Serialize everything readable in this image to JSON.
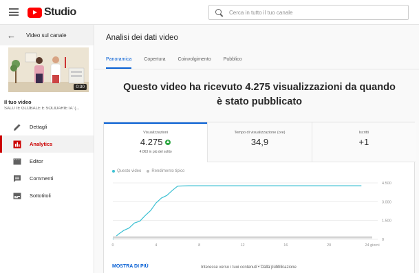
{
  "header": {
    "logo_text": "Studio",
    "search_placeholder": "Cerca in tutto il tuo canale",
    "brand_color": "#ff0000"
  },
  "sidebar": {
    "back_label": "Video sul canale",
    "thumbnail_duration": "0:30",
    "your_video_label": "Il tuo video",
    "channel_name": "SALUTE GLOBALE E SOLIDARIETA' (...",
    "items": [
      {
        "label": "Dettagli",
        "icon": "pencil-icon",
        "active": false
      },
      {
        "label": "Analytics",
        "icon": "analytics-icon",
        "active": true
      },
      {
        "label": "Editor",
        "icon": "film-icon",
        "active": false
      },
      {
        "label": "Commenti",
        "icon": "comment-icon",
        "active": false
      },
      {
        "label": "Sottotitoli",
        "icon": "subtitles-icon",
        "active": false
      }
    ]
  },
  "main": {
    "title": "Analisi dei dati video",
    "tabs": [
      {
        "label": "Panoramica",
        "active": true
      },
      {
        "label": "Copertura",
        "active": false
      },
      {
        "label": "Coinvolgimento",
        "active": false
      },
      {
        "label": "Pubblico",
        "active": false
      }
    ],
    "headline": "Questo video ha ricevuto 4.275 visualizzazioni da quando è stato pubblicato",
    "metrics": [
      {
        "label": "Visualizzazioni",
        "value": "4.275",
        "sub": "4.063 in più del solito",
        "trend": "up"
      },
      {
        "label": "Tempo di visualizzazione (ore)",
        "value": "34,9",
        "sub": ""
      },
      {
        "label": "Iscritti",
        "value": "+1",
        "sub": ""
      }
    ],
    "legend": {
      "this_video": "Questo video",
      "typical": "Rendimento tipico"
    },
    "show_more": "MOSTRA DI PIÙ",
    "footer_text": "Interesse verso i tuoi contenuti • Dalla pubblicazione"
  },
  "chart_data": {
    "type": "line",
    "x_tick_labels": [
      "0",
      "4",
      "8",
      "12",
      "16",
      "20",
      "24 giorni"
    ],
    "y_tick_labels": [
      "0",
      "1.500",
      "3.000",
      "4.500"
    ],
    "xlim": [
      0,
      24
    ],
    "ylim": [
      0,
      4500
    ],
    "series": [
      {
        "name": "Questo video",
        "color": "#3ec1d3",
        "x": [
          0,
          0.5,
          1,
          1.5,
          2,
          2.5,
          3,
          3.5,
          4,
          4.5,
          5,
          5.5,
          6,
          7,
          8,
          10,
          12,
          16,
          20,
          23
        ],
        "y": [
          0,
          400,
          700,
          900,
          1300,
          1450,
          1900,
          2300,
          2900,
          3300,
          3500,
          3900,
          4250,
          4275,
          4275,
          4275,
          4275,
          4275,
          4275,
          4275
        ]
      },
      {
        "name": "Rendimento tipico",
        "color": "#cccccc",
        "x": [
          0,
          24
        ],
        "y": [
          150,
          150
        ]
      }
    ]
  }
}
